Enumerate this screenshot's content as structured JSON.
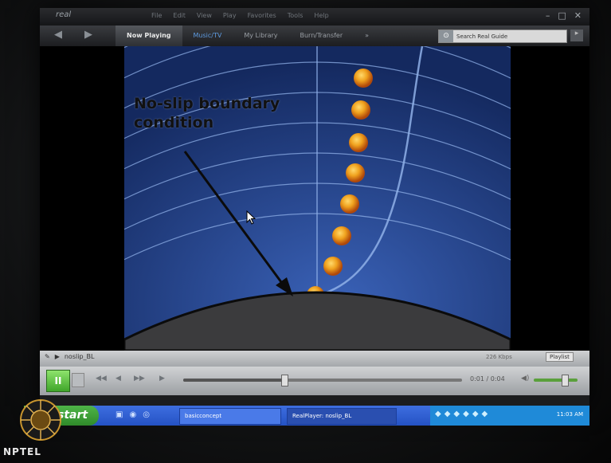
{
  "player": {
    "logo": "real",
    "menu": [
      "File",
      "Edit",
      "View",
      "Play",
      "Favorites",
      "Tools",
      "Help"
    ],
    "window_controls": [
      "–",
      "□",
      "✕"
    ],
    "tabs": [
      "Now Playing",
      "Music/TV",
      "My Library",
      "Burn/Transfer",
      "»"
    ],
    "search_placeholder": "Search Real Guide",
    "clip_name": "noslip_BL",
    "rate": "226 Kbps",
    "playlist_label": "Playlist",
    "time": "0:01 / 0:04",
    "progress": 0.36,
    "volume": 0.7
  },
  "slide": {
    "title_line1": "No-slip boundary",
    "title_line2": "condition"
  },
  "taskbar": {
    "start_label": "start",
    "tasks": [
      "basicconcept",
      "RealPlayer: noslip_BL"
    ],
    "clock": "11:03 AM"
  },
  "watermark": "NPTEL",
  "colors": {
    "slide_blue": "#1f3d86",
    "ball_orange": "#e0891c",
    "tab_active": "#55585d",
    "start_green": "#3fa52a"
  }
}
